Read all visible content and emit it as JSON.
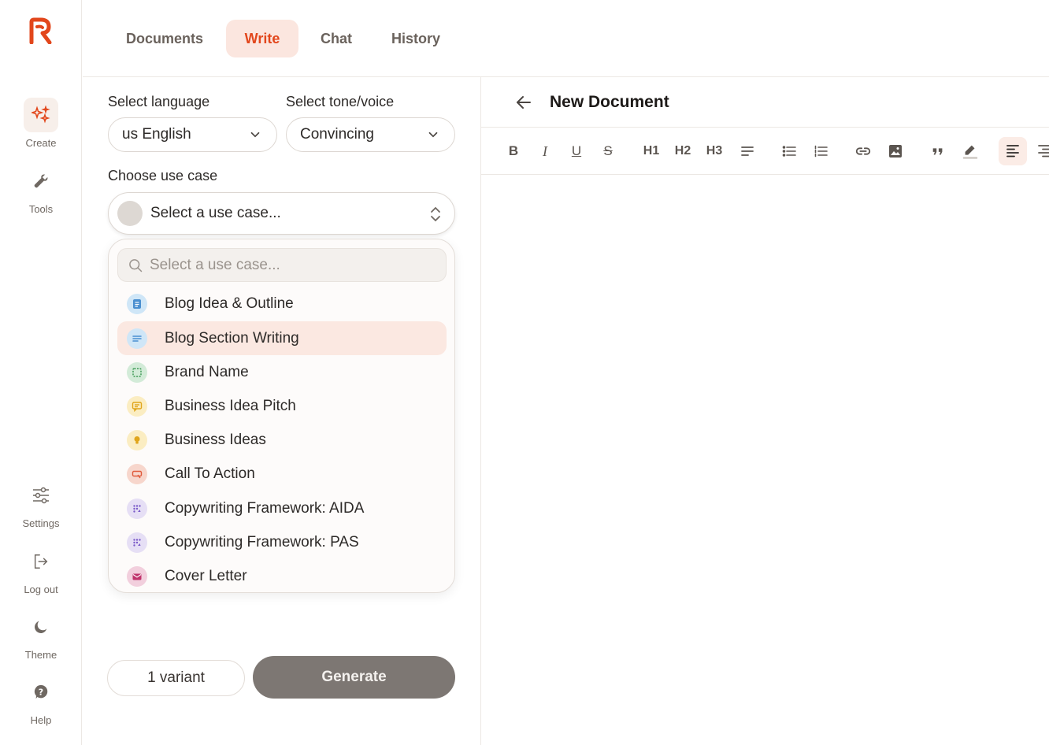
{
  "sidebar": {
    "items": [
      {
        "label": "Create",
        "icon": "sparkles-icon"
      },
      {
        "label": "Tools",
        "icon": "wrench-icon"
      },
      {
        "label": "Settings",
        "icon": "sliders-icon"
      },
      {
        "label": "Log out",
        "icon": "logout-icon"
      },
      {
        "label": "Theme",
        "icon": "moon-icon"
      },
      {
        "label": "Help",
        "icon": "help-icon"
      }
    ]
  },
  "tabs": [
    {
      "label": "Documents"
    },
    {
      "label": "Write",
      "active": true
    },
    {
      "label": "Chat"
    },
    {
      "label": "History"
    }
  ],
  "form": {
    "language_label": "Select language",
    "language_value": "us English",
    "tone_label": "Select tone/voice",
    "tone_value": "Convincing",
    "usecase_label": "Choose use case",
    "usecase_value": "Select a use case...",
    "search_placeholder": "Select a use case...",
    "variant_label": "1 variant",
    "generate_label": "Generate"
  },
  "use_cases": [
    {
      "label": "Blog Idea & Outline",
      "icon": "document-icon",
      "color": "#4a8fd0",
      "bg": "#cfe6f7"
    },
    {
      "label": "Blog Section Writing",
      "icon": "text-lines-icon",
      "color": "#4a8fd0",
      "bg": "#cfe6f7",
      "highlighted": true
    },
    {
      "label": "Brand Name",
      "icon": "dashed-square-icon",
      "color": "#3f9a55",
      "bg": "#d3ebd8"
    },
    {
      "label": "Business Idea Pitch",
      "icon": "message-icon",
      "color": "#e0a51b",
      "bg": "#fbedc2"
    },
    {
      "label": "Business Ideas",
      "icon": "lightbulb-icon",
      "color": "#e0a51b",
      "bg": "#fbedc2"
    },
    {
      "label": "Call To Action",
      "icon": "cursor-box-icon",
      "color": "#e05a3c",
      "bg": "#f7d6cc"
    },
    {
      "label": "Copywriting Framework: AIDA",
      "icon": "grid-dots-icon",
      "color": "#7b5bc9",
      "bg": "#e6dff5"
    },
    {
      "label": "Copywriting Framework: PAS",
      "icon": "grid-dots-icon",
      "color": "#7b5bc9",
      "bg": "#e6dff5"
    },
    {
      "label": "Cover Letter",
      "icon": "envelope-icon",
      "color": "#c0346d",
      "bg": "#f2cfdd"
    }
  ],
  "editor": {
    "title": "New Document",
    "toolbar": [
      "bold",
      "italic",
      "underline",
      "strikethrough",
      "H1",
      "H2",
      "H3",
      "paragraph",
      "bullet-list",
      "numbered-list",
      "link",
      "image",
      "quote",
      "highlight",
      "align-left",
      "align-right"
    ]
  },
  "colors": {
    "accent": "#e2471c",
    "tab_active_bg": "#fbe6df",
    "generate_bg": "#7d7773"
  }
}
